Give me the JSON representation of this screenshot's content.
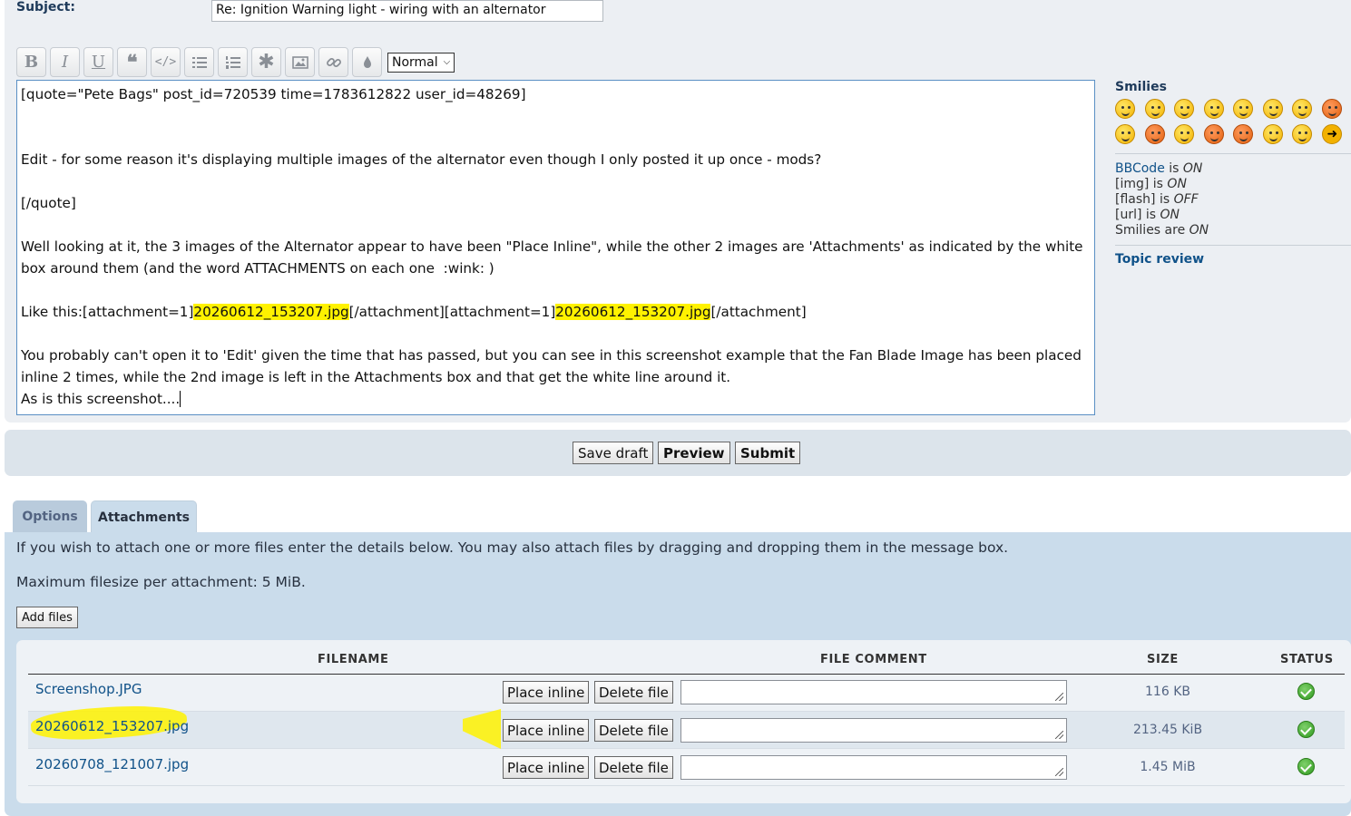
{
  "subject": {
    "label": "Subject:",
    "value": "Re: Ignition Warning light - wiring with an alternator"
  },
  "toolbar": {
    "buttons": [
      "bold-icon",
      "italic-icon",
      "underline-icon",
      "quote-icon",
      "code-icon",
      "list-icon",
      "numbered-list-icon",
      "asterisk-icon",
      "image-icon",
      "link-icon",
      "color-drop-icon"
    ],
    "font_size": "Normal"
  },
  "editor": {
    "line1": "[quote=\"Pete Bags\" post_id=720539 time=1783612822 user_id=48269]",
    "line2": "Edit - for some reason it's displaying multiple images of the alternator even though I only posted it up once - mods?",
    "line3": "[/quote]",
    "line4": "Well looking at it, the 3 images of the Alternator appear to have been \"Place Inline\", while the other 2 images are 'Attachments' as indicated by the white box around them (and the word ATTACHMENTS on each one  :wink: )",
    "line5a": "Like this:[attachment=1]",
    "line5b": "20260612_153207.jpg",
    "line5c": "[/attachment][attachment=1]",
    "line5d": "20260612_153207.jpg",
    "line5e": "[/attachment]",
    "line6": "You probably can't open it to 'Edit' given the time that has passed, but you can see in this screenshot example that the Fan Blade Image has been placed inline 2 times, while the 2nd image is left in the Attachments box and that get the white line around it.",
    "line7": "As is this screenshot...."
  },
  "sidebar": {
    "smilies_title": "Smilies",
    "bbcode_link": "BBCode",
    "bbcode_is": " is ",
    "bbcode_state": "ON",
    "img_label": "[img] is ",
    "img_state": "ON",
    "flash_label": "[flash] is ",
    "flash_state": "OFF",
    "url_label": "[url] is ",
    "url_state": "ON",
    "smilies_label": "Smilies are ",
    "smilies_state": "ON",
    "topic_review": "Topic review"
  },
  "actions": {
    "save_draft": "Save draft",
    "preview": "Preview",
    "submit": "Submit"
  },
  "tabs": {
    "options": "Options",
    "attachments": "Attachments"
  },
  "attachments": {
    "intro": "If you wish to attach one or more files enter the details below. You may also attach files by dragging and dropping them in the message box.",
    "max_size": "Maximum filesize per attachment: 5 MiB.",
    "add_files": "Add files",
    "headers": {
      "filename": "FILENAME",
      "comment": "FILE COMMENT",
      "size": "SIZE",
      "status": "STATUS"
    },
    "place_inline": "Place inline",
    "delete_file": "Delete file",
    "files": [
      {
        "name": "Screenshop.JPG",
        "size": "116 KB"
      },
      {
        "name": "20260612_153207.jpg",
        "size": "213.45 KiB"
      },
      {
        "name": "20260708_121007.jpg",
        "size": "1.45 MiB"
      }
    ]
  }
}
